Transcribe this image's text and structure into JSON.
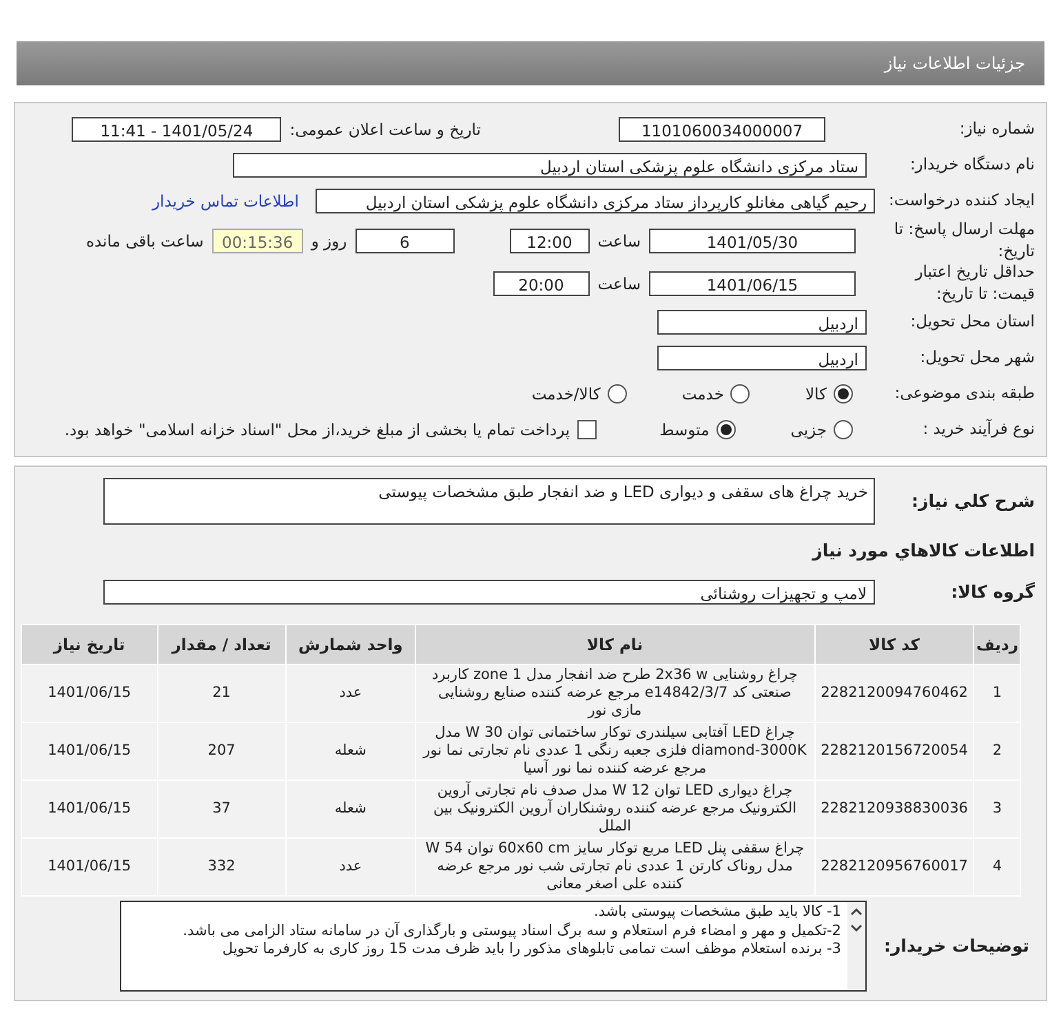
{
  "header": {
    "title": "جزئیات اطلاعات نیاز"
  },
  "need_number": {
    "label": "شماره نیاز:",
    "value": "1101060034000007"
  },
  "announce": {
    "label": "تاریخ و ساعت اعلان عمومی:",
    "value": "1401/05/24 - 11:41"
  },
  "buyer_org": {
    "label": "نام دستگاه خریدار:",
    "value": "ستاد مرکزی دانشگاه علوم پزشکی استان اردبیل"
  },
  "requester": {
    "label": "ایجاد کننده درخواست:",
    "value": "رحیم گیاهی مغانلو کارپرداز ستاد مرکزی دانشگاه علوم پزشکی استان اردبیل",
    "contact_link": "اطلاعات تماس خریدار"
  },
  "deadline": {
    "label": "مهلت ارسال پاسخ: تا تاریخ:",
    "date": "1401/05/30",
    "time_label": "ساعت",
    "time": "12:00",
    "days": "6",
    "days_label": "روز و",
    "remaining": "00:15:36",
    "remaining_label": "ساعت باقی مانده"
  },
  "validity": {
    "label": "حداقل تاریخ اعتبار قیمت: تا تاریخ:",
    "date": "1401/06/15",
    "time_label": "ساعت",
    "time": "20:00"
  },
  "province": {
    "label": "استان محل تحویل:",
    "value": "اردبیل"
  },
  "city": {
    "label": "شهر محل تحویل:",
    "value": "اردبیل"
  },
  "category": {
    "label": "طبقه بندی موضوعی:",
    "options": [
      {
        "label": "کالا",
        "selected": true
      },
      {
        "label": "خدمت",
        "selected": false
      },
      {
        "label": "کالا/خدمت",
        "selected": false
      }
    ]
  },
  "process": {
    "label": "نوع فرآیند خرید :",
    "options": [
      {
        "label": "جزیی",
        "selected": false
      },
      {
        "label": "متوسط",
        "selected": true
      }
    ],
    "payment": {
      "label": "پرداخت تمام یا بخشی از مبلغ خرید،از محل \"اسناد خزانه اسلامی\" خواهد بود.",
      "checked": false
    }
  },
  "description": {
    "label": "شرح کلي نياز:",
    "value": "خرید چراغ های سقفی و دیواری LED و ضد انفجار طبق مشخصات پیوستی"
  },
  "items_title": "اطلاعات کالاهاي مورد نياز",
  "group": {
    "label": "گروه کالا:",
    "value": "لامپ و تجهیزات روشنائی"
  },
  "table": {
    "columns": [
      "ردیف",
      "کد کالا",
      "نام کالا",
      "واحد شمارش",
      "تعداد / مقدار",
      "تاریخ نیاز"
    ],
    "rows": [
      [
        "1",
        "2282120094760462",
        "چراغ روشنایی 2x36 w طرح ضد انفجار مدل zone 1 کاربرد صنعتی کد e14842/3/7 مرجع عرضه کننده صنایع روشنایی مازی نور",
        "عدد",
        "21",
        "1401/06/15"
      ],
      [
        "2",
        "2282120156720054",
        "چراغ LED آفتابی سیلندری توکار ساختمانی توان W 30 مدل diamond-3000K فلزی جعبه رنگی 1 عددی نام تجارتی نما نور مرجع عرضه کننده نما نور آسیا",
        "شعله",
        "207",
        "1401/06/15"
      ],
      [
        "3",
        "2282120938830036",
        "چراغ دیواری LED توان W 12 مدل صدف نام تجارتی آروین الکترونیک مرجع عرضه کننده روشنکاران آروین الکترونیک بین الملل",
        "شعله",
        "37",
        "1401/06/15"
      ],
      [
        "4",
        "2282120956760017",
        "چراغ سقفی پنل LED مربع توکار سایز 60x60 cm توان W 54 مدل روناک کارتن 1 عددی نام تجارتی شب نور مرجع عرضه کننده علی اصغر معانی",
        "عدد",
        "332",
        "1401/06/15"
      ]
    ]
  },
  "buyer_notes": {
    "label": "توضیحات خریدار:",
    "lines": [
      "1- کالا باید طبق مشخصات پیوستی باشد.",
      "2-تکمیل و مهر و امضاء فرم استعلام و سه  برگ اسناد پیوستی و بارگذاری آن در سامانه ستاد الزامی می باشد.",
      "3- برنده استعلام موظف است تمامی تابلوهای مذکور  را باید ظرف مدت 15 روز کاری به کارفرما تحویل"
    ]
  }
}
